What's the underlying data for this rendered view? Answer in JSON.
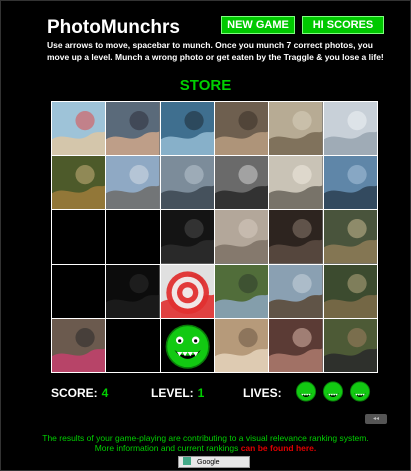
{
  "game": {
    "title": "PhotoMunchrs",
    "new_game_label": "NEW GAME",
    "hi_scores_label": "HI SCORES",
    "instructions": "Use arrows to move, spacebar to munch. Once you munch 7 correct photos, you move up a level. Munch a wrong photo or get eaten by the Traggle & you lose a life!",
    "category": "STORE"
  },
  "hud": {
    "score_label": "SCORE:",
    "score_value": "4",
    "level_label": "LEVEL:",
    "level_value": "1",
    "lives_label": "LIVES:",
    "lives_count": 3
  },
  "footer": {
    "line1": "The results of your game-playing are contributing to a visual relevance ranking system.",
    "line2_prefix": "More information and current rankings",
    "line2_link": "can be found here.",
    "google_button": "Google"
  },
  "colors": {
    "accent_green": "#00d000",
    "button_green": "#00c800",
    "link_red": "#e00000",
    "background": "#000000"
  },
  "board": {
    "rows": 5,
    "cols": 6,
    "cells": [
      {
        "type": "photo",
        "subject": "child-and-woman-at-beach"
      },
      {
        "type": "photo",
        "subject": "couple-portrait"
      },
      {
        "type": "photo",
        "subject": "blue-fan-object"
      },
      {
        "type": "photo",
        "subject": "man-in-workshop"
      },
      {
        "type": "photo",
        "subject": "man-with-shop-vac"
      },
      {
        "type": "photo",
        "subject": "white-room-window"
      },
      {
        "type": "photo",
        "subject": "brown-bird"
      },
      {
        "type": "photo",
        "subject": "city-skyline"
      },
      {
        "type": "photo",
        "subject": "bridge-over-river"
      },
      {
        "type": "photo",
        "subject": "speaker-product"
      },
      {
        "type": "photo",
        "subject": "electronic-device"
      },
      {
        "type": "photo",
        "subject": "harbor-dock"
      },
      {
        "type": "empty"
      },
      {
        "type": "empty"
      },
      {
        "type": "photo",
        "subject": "dark-doorway"
      },
      {
        "type": "photo",
        "subject": "room-corner"
      },
      {
        "type": "photo",
        "subject": "dim-room-with-frames"
      },
      {
        "type": "photo",
        "subject": "people-in-woods"
      },
      {
        "type": "empty"
      },
      {
        "type": "photo",
        "subject": "dark-garden"
      },
      {
        "type": "photo",
        "subject": "target-bullseye"
      },
      {
        "type": "photo",
        "subject": "man-in-cap-outdoors"
      },
      {
        "type": "photo",
        "subject": "bare-trees-road"
      },
      {
        "type": "photo",
        "subject": "people-in-forest"
      },
      {
        "type": "photo",
        "subject": "woman-with-scarf"
      },
      {
        "type": "empty"
      },
      {
        "type": "muncher",
        "subject": "green-muncher-character"
      },
      {
        "type": "photo",
        "subject": "sony-ericsson-box"
      },
      {
        "type": "photo",
        "subject": "people-on-couch"
      },
      {
        "type": "photo",
        "subject": "man-in-hat"
      }
    ]
  }
}
